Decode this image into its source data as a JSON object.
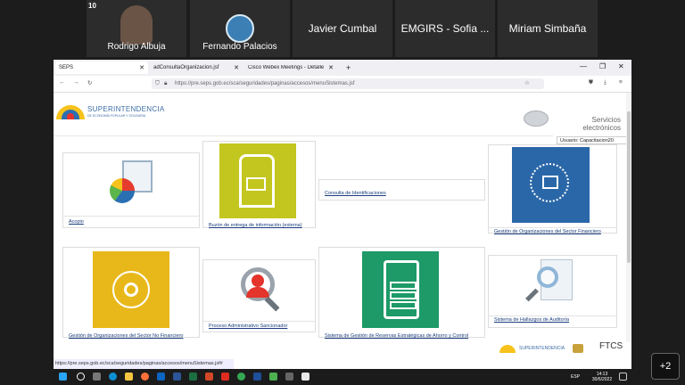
{
  "participants": [
    {
      "name": "Rodrigo Albuja"
    },
    {
      "name": "Fernando Palacios"
    },
    {
      "name": "Javier Cumbal"
    },
    {
      "name": "EMGIRS - Sofia ..."
    },
    {
      "name": "Miriam Simbaña"
    }
  ],
  "more_participants": "+2",
  "browser": {
    "tabs": [
      {
        "label": "SEPS"
      },
      {
        "label": "adConsultaOrganizacion.jsf"
      },
      {
        "label": "Cisco Webex Meetings - Detalle"
      }
    ],
    "new_tab": "+",
    "url": "https://pre.seps.gob.ec/sca/seguridades/paginas/accesos/menuSistemas.jsf",
    "status_url": "https://pre.seps.gob.ec/sca/seguridades/paginas/accesos/menuSistemas.jsf#"
  },
  "header": {
    "logo_title": "SUPERINTENDENCIA",
    "logo_subtitle": "DE ECONOMÍA POPULAR Y SOLIDARIA",
    "services_line1": "Servicios",
    "services_line2": "electrónicos",
    "user": "Usuario: Capacitacion20"
  },
  "cards": [
    {
      "label": "Acopio",
      "color": "#ffffff"
    },
    {
      "label": "Buzón de entrega de información (externa)",
      "color": "#c3c61e"
    },
    {
      "label": "Consulta de Identificaciones",
      "color": "#ffffff"
    },
    {
      "label": "Gestión de Organizaciones del Sector Financiero",
      "color": "#2a67a8"
    },
    {
      "label": "Gestión de Organizaciones del Sector No Financiero",
      "color": "#e8b81a"
    },
    {
      "label": "Proceso Administrativo Sancionador",
      "color": "#ffffff"
    },
    {
      "label": "Sistema de Gestión de Reservas Estratégicas de Ahorro y Control",
      "color": "#1d9a67"
    },
    {
      "label": "Sistema de Hallazgos de Auditoría",
      "color": "#ffffff"
    }
  ],
  "footer": {
    "logo_title": "SUPERINTENDENCIA",
    "ftcs": "FTCS"
  },
  "taskbar": {
    "lang": "ESP",
    "time": "14:13",
    "date": "30/6/2022"
  }
}
